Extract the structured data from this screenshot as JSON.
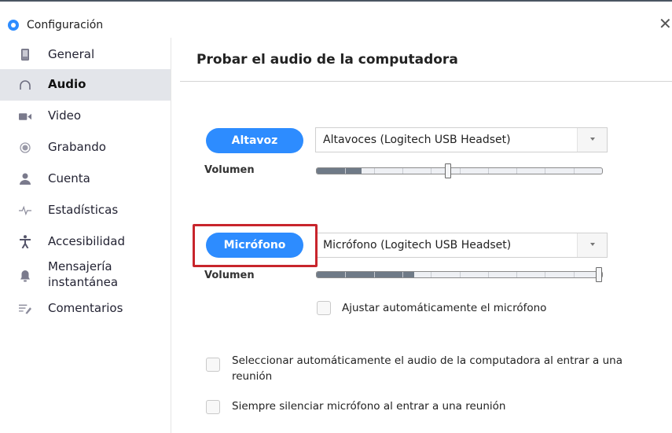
{
  "window": {
    "title": "Configuración",
    "close_symbol": "✕"
  },
  "sidebar": {
    "items": [
      {
        "label": "General",
        "icon": "phone-device-icon",
        "active": false
      },
      {
        "label": "Audio",
        "icon": "headphones-icon",
        "active": true
      },
      {
        "label": "Video",
        "icon": "video-camera-icon",
        "active": false
      },
      {
        "label": "Grabando",
        "icon": "record-icon",
        "active": false
      },
      {
        "label": "Cuenta",
        "icon": "user-icon",
        "active": false
      },
      {
        "label": "Estadísticas",
        "icon": "pulse-icon",
        "active": false
      },
      {
        "label": "Accesibilidad",
        "icon": "accessibility-icon",
        "active": false
      },
      {
        "label": "Mensajería\ninstantánea",
        "icon": "bell-icon",
        "active": false
      },
      {
        "label": "Comentarios",
        "icon": "feedback-icon",
        "active": false
      }
    ]
  },
  "main": {
    "title": "Probar el audio de la computadora",
    "speaker": {
      "button_label": "Altavoz",
      "device": "Altavoces (Logitech USB Headset)",
      "volume_label": "Volumen",
      "volume_fraction": 0.46
    },
    "microphone": {
      "button_label": "Micrófono",
      "device": "Micrófono (Logitech USB Headset)",
      "volume_label": "Volumen",
      "volume_fraction": 1.0,
      "auto_adjust_label": "Ajustar automáticamente el micrófono",
      "auto_adjust_checked": false
    },
    "options": [
      {
        "label": "Seleccionar automáticamente el audio de la computadora al entrar a una reunión",
        "checked": false
      },
      {
        "label": "Siempre silenciar micrófono al entrar a una reunión",
        "checked": false
      }
    ]
  },
  "colors": {
    "accent": "#2d8cff",
    "active_nav_bg": "#e3e5ea",
    "highlight_border": "#c8252c"
  }
}
